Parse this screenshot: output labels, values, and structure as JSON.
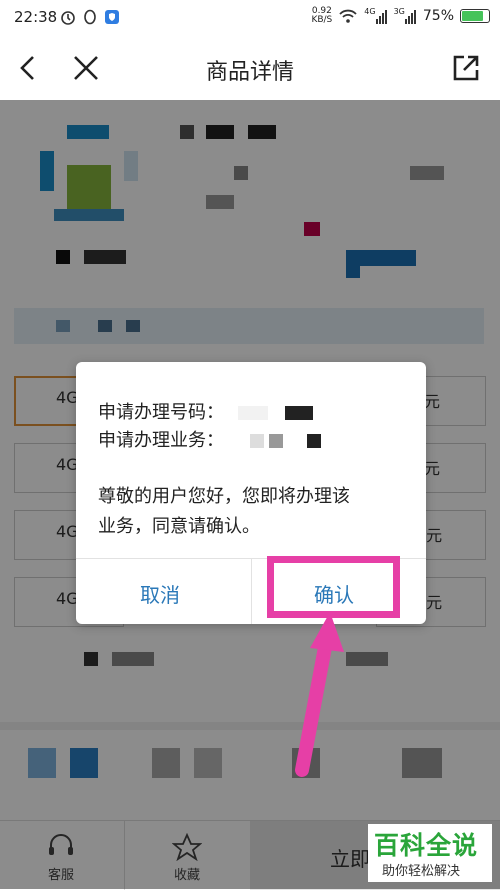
{
  "status_bar": {
    "time": "22:38",
    "network_speed": "0.92",
    "network_unit": "KB/S",
    "signal_1": "4G",
    "signal_2": "3G",
    "battery": "75%"
  },
  "nav": {
    "title": "商品详情"
  },
  "dialog": {
    "line_number_label": "申请办理号码：",
    "line_service_label": "申请办理业务：",
    "message_line1": "尊敬的用户您好，您即将办理该",
    "message_line2": "业务，同意请确认。",
    "cancel_label": "取消",
    "confirm_label": "确认"
  },
  "background_list": {
    "row_prefix": [
      "4G",
      "4G",
      "4G",
      "4G"
    ],
    "row_suffix": [
      "元",
      "元",
      "3元",
      "3元"
    ]
  },
  "bottom_bar": {
    "service_label": "客服",
    "favorite_label": "收藏",
    "buy_partial": "立即"
  },
  "watermark": {
    "main": "百科全说",
    "sub": "助你轻松解决"
  },
  "colors": {
    "accent_blue": "#2a78b8",
    "highlight_pink": "#e63fa6",
    "battery_green": "#46c35a",
    "watermark_green": "#2aa53a"
  }
}
